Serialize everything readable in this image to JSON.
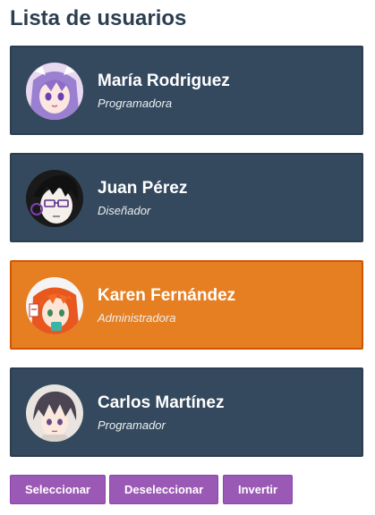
{
  "page": {
    "title": "Lista de usuarios"
  },
  "users": [
    {
      "name": "María Rodriguez",
      "role": "Programadora",
      "avatar": "anime-girl-purple-hair-avatar",
      "selected": false
    },
    {
      "name": "Juan Pérez",
      "role": "Diseñador",
      "avatar": "anime-boy-glasses-avatar",
      "selected": false
    },
    {
      "name": "Karen Fernández",
      "role": "Administradora",
      "avatar": "anime-girl-orange-hair-avatar",
      "selected": true
    },
    {
      "name": "Carlos Martínez",
      "role": "Programador",
      "avatar": "anime-boy-dark-hair-avatar",
      "selected": false
    }
  ],
  "actions": {
    "select_label": "Seleccionar",
    "deselect_label": "Deseleccionar",
    "invert_label": "Invertir"
  },
  "colors": {
    "card_bg": "#34495e",
    "card_selected_bg": "#e67e22",
    "button_bg": "#9b59b6",
    "title": "#2c3e50"
  }
}
